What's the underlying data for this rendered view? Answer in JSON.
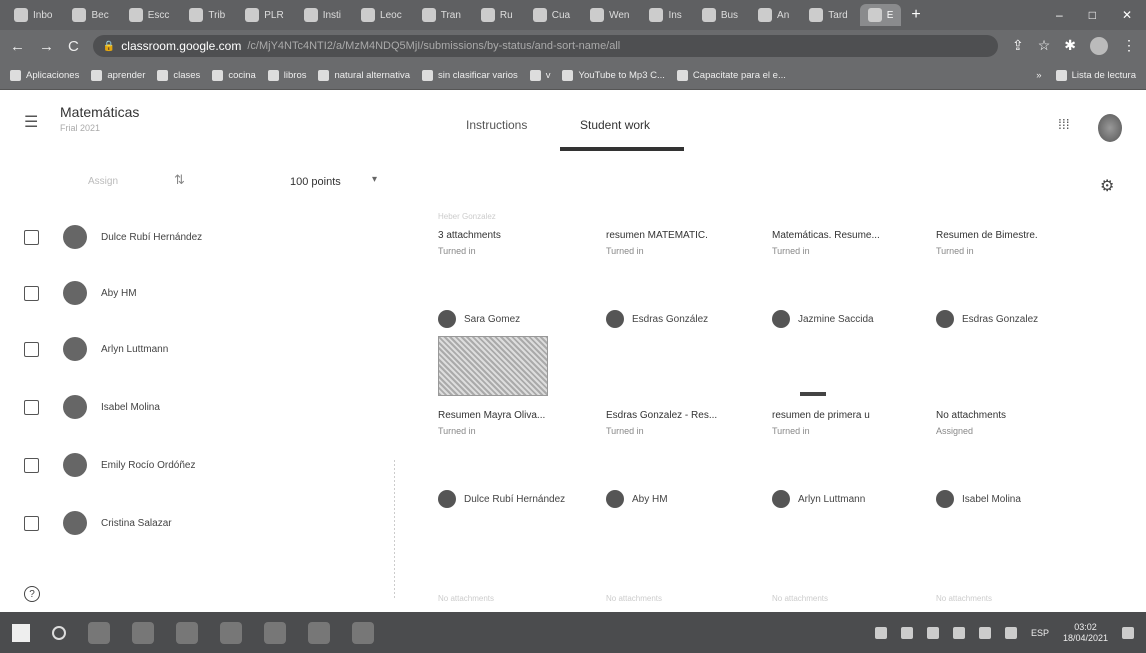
{
  "browser": {
    "tabs": [
      {
        "label": "Inbo"
      },
      {
        "label": "Bec"
      },
      {
        "label": "Escc"
      },
      {
        "label": "Trib"
      },
      {
        "label": "PLR"
      },
      {
        "label": "Insti"
      },
      {
        "label": "Leoc"
      },
      {
        "label": "Tran"
      },
      {
        "label": "Ru"
      },
      {
        "label": "Cua"
      },
      {
        "label": "Wen"
      },
      {
        "label": "Ins"
      },
      {
        "label": "Bus"
      },
      {
        "label": "An"
      },
      {
        "label": "Tard"
      },
      {
        "label": "E"
      }
    ],
    "new_tab": "+",
    "window_controls": {
      "minimize": "–",
      "maximize": "□",
      "close": "✕"
    },
    "url_domain": "classroom.google.com",
    "url_path": "/c/MjY4NTc4NTI2/a/MzM4NDQ5MjI/submissions/by-status/and-sort-name/all"
  },
  "bookmarks": [
    {
      "label": "Aplicaciones"
    },
    {
      "label": "aprender"
    },
    {
      "label": "clases"
    },
    {
      "label": "cocina"
    },
    {
      "label": "libros"
    },
    {
      "label": "natural alternativa"
    },
    {
      "label": "sin clasificar varios"
    },
    {
      "label": "v"
    },
    {
      "label": "YouTube to Mp3 C..."
    },
    {
      "label": "Capacitate para el e..."
    }
  ],
  "bookmarks_right": {
    "more": "»",
    "reading_list": "Lista de lectura"
  },
  "header": {
    "class_name": "Matemáticas",
    "class_sub": "Frial 2021",
    "tab_instructions": "Instructions",
    "tab_student_work": "Student work"
  },
  "toolbar": {
    "sort_label": "Assign",
    "points": "100 points"
  },
  "students": [
    {
      "name": "Dulce Rubí Hernández"
    },
    {
      "name": "Aby HM"
    },
    {
      "name": "Arlyn Luttmann"
    },
    {
      "name": "Isabel Molina"
    },
    {
      "name": "Emily Rocío Ordóñez"
    },
    {
      "name": "Cristina Salazar"
    }
  ],
  "cards_row1": [
    {
      "title": "3 attachments",
      "status": "Turned in"
    },
    {
      "title": "resumen MATEMATIC.",
      "status": "Turned in"
    },
    {
      "title": "Matemáticas. Resume...",
      "status": "Turned in"
    },
    {
      "title": "Resumen de Bimestre.",
      "status": "Turned in"
    }
  ],
  "row1_header_faint": "Heber Gonzalez",
  "cards_row2_names": [
    {
      "name": "Sara Gomez"
    },
    {
      "name": "Esdras González"
    },
    {
      "name": "Jazmine Saccida"
    },
    {
      "name": "Esdras Gonzalez"
    }
  ],
  "cards_row2": [
    {
      "title": "Resumen Mayra Oliva...",
      "status": "Turned in"
    },
    {
      "title": "Esdras Gonzalez - Res...",
      "status": "Turned in"
    },
    {
      "title": "resumen de primera u",
      "status": "Turned in"
    },
    {
      "title": "No attachments",
      "status": "Assigned"
    }
  ],
  "cards_row3_names": [
    {
      "name": "Dulce Rubí Hernández"
    },
    {
      "name": "Aby HM"
    },
    {
      "name": "Arlyn Luttmann"
    },
    {
      "name": "Isabel Molina"
    }
  ],
  "cards_row4_faint": [
    {
      "label": "No attachments"
    },
    {
      "label": "No attachments"
    },
    {
      "label": "No attachments"
    },
    {
      "label": "No attachments"
    }
  ],
  "taskbar": {
    "lang": "ESP",
    "time": "03:02",
    "date": "18/04/2021"
  }
}
